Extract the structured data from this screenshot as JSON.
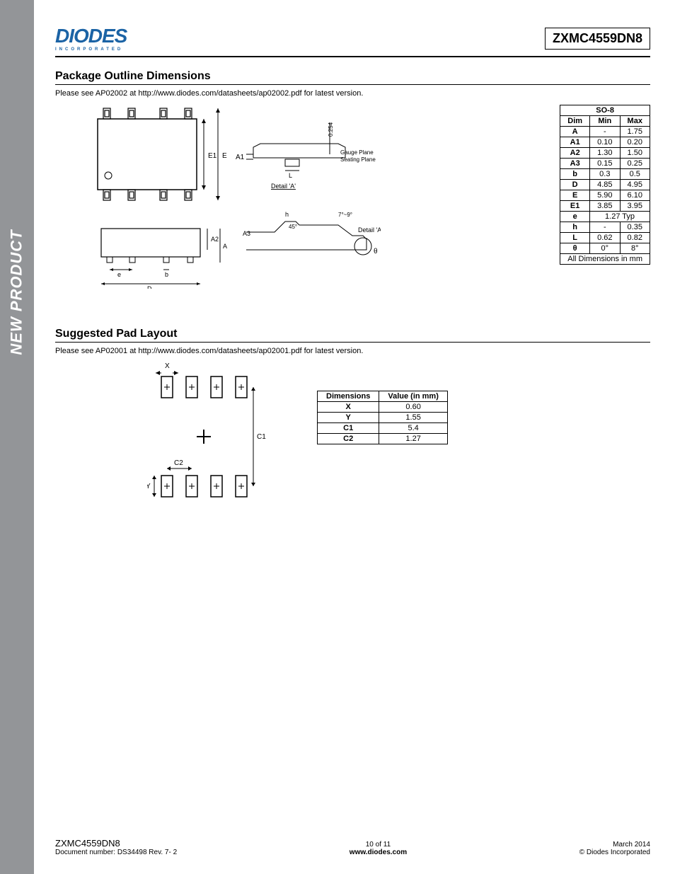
{
  "header": {
    "brand_main": "DIODES",
    "brand_sub": "INCORPORATED",
    "part_number": "ZXMC4559DN8"
  },
  "sidebar": {
    "label": "NEW PRODUCT"
  },
  "section1": {
    "title": "Package Outline Dimensions",
    "note": "Please see AP02002 at http://www.diodes.com/datasheets/ap02002.pdf for latest version.",
    "table_title": "SO-8",
    "headers": {
      "dim": "Dim",
      "min": "Min",
      "max": "Max"
    },
    "rows": [
      {
        "dim": "A",
        "min": "-",
        "max": "1.75"
      },
      {
        "dim": "A1",
        "min": "0.10",
        "max": "0.20"
      },
      {
        "dim": "A2",
        "min": "1.30",
        "max": "1.50"
      },
      {
        "dim": "A3",
        "min": "0.15",
        "max": "0.25"
      },
      {
        "dim": "b",
        "min": "0.3",
        "max": "0.5"
      },
      {
        "dim": "D",
        "min": "4.85",
        "max": "4.95"
      },
      {
        "dim": "E",
        "min": "5.90",
        "max": "6.10"
      },
      {
        "dim": "E1",
        "min": "3.85",
        "max": "3.95"
      },
      {
        "dim": "e",
        "min": "1.27 Typ",
        "max": ""
      },
      {
        "dim": "h",
        "min": "-",
        "max": "0.35"
      },
      {
        "dim": "L",
        "min": "0.62",
        "max": "0.82"
      },
      {
        "dim": "θ",
        "min": "0°",
        "max": "8°"
      }
    ],
    "footer_note": "All Dimensions in mm",
    "diagram_labels": {
      "E1": "E1",
      "E": "E",
      "A1": "A1",
      "L": "L",
      "detailA": "Detail 'A'",
      "gauge": "Gauge Plane",
      "seating": "Seating Plane",
      "r254": "0.254",
      "h": "h",
      "ang45": "45°",
      "ang79": "7°~9°",
      "A2": "A2",
      "A": "A",
      "A3": "A3",
      "theta": "θ",
      "e": "e",
      "b": "b",
      "D": "D"
    }
  },
  "section2": {
    "title": "Suggested Pad Layout",
    "note": "Please see AP02001 at http://www.diodes.com/datasheets/ap02001.pdf for latest version.",
    "headers": {
      "dim": "Dimensions",
      "val": "Value (in mm)"
    },
    "rows": [
      {
        "dim": "X",
        "val": "0.60"
      },
      {
        "dim": "Y",
        "val": "1.55"
      },
      {
        "dim": "C1",
        "val": "5.4"
      },
      {
        "dim": "C2",
        "val": "1.27"
      }
    ],
    "diagram_labels": {
      "X": "X",
      "Y": "Y",
      "C1": "C1",
      "C2": "C2"
    }
  },
  "footer": {
    "part_number": "ZXMC4559DN8",
    "doc": "Document number: DS34498  Rev. 7- 2",
    "page": "10 of 11",
    "url": "www.diodes.com",
    "date": "March 2014",
    "copyright": "© Diodes Incorporated"
  }
}
